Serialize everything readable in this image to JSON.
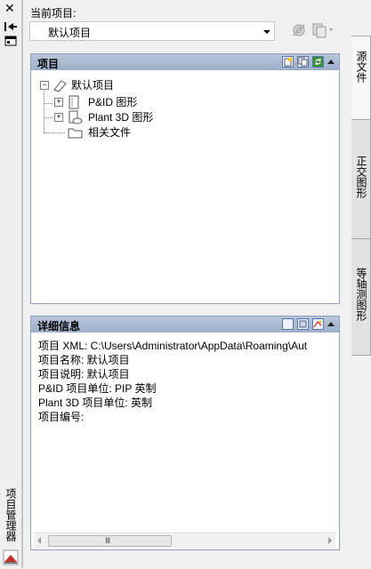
{
  "sidebar": {
    "close_glyph": "✕",
    "title": "项目管理器"
  },
  "header": {
    "current_project_label": "当前项目:",
    "current_project_value": "默认项目"
  },
  "project_panel": {
    "title": "项目",
    "tree": [
      {
        "label": "默认项目",
        "level": 0,
        "expander": "−",
        "icon": "project-icon"
      },
      {
        "label": "P&ID 图形",
        "level": 1,
        "expander": "+",
        "icon": "pid-drawings-icon"
      },
      {
        "label": "Plant 3D 图形",
        "level": 1,
        "expander": "+",
        "icon": "plant3d-drawings-icon"
      },
      {
        "label": "相关文件",
        "level": 1,
        "expander": "",
        "icon": "folder-icon"
      }
    ]
  },
  "details_panel": {
    "title": "详细信息",
    "lines": [
      "项目 XML: C:\\Users\\Administrator\\AppData\\Roaming\\Aut",
      "项目名称: 默认项目",
      "项目说明: 默认项目",
      "P&ID 项目单位: PIP 英制",
      "Plant 3D 项目单位: 英制",
      "项目编号:"
    ],
    "scroll_grip": "Ⅲ"
  },
  "right_tabs": [
    "源文件",
    "正交图形",
    "等轴测图形"
  ]
}
